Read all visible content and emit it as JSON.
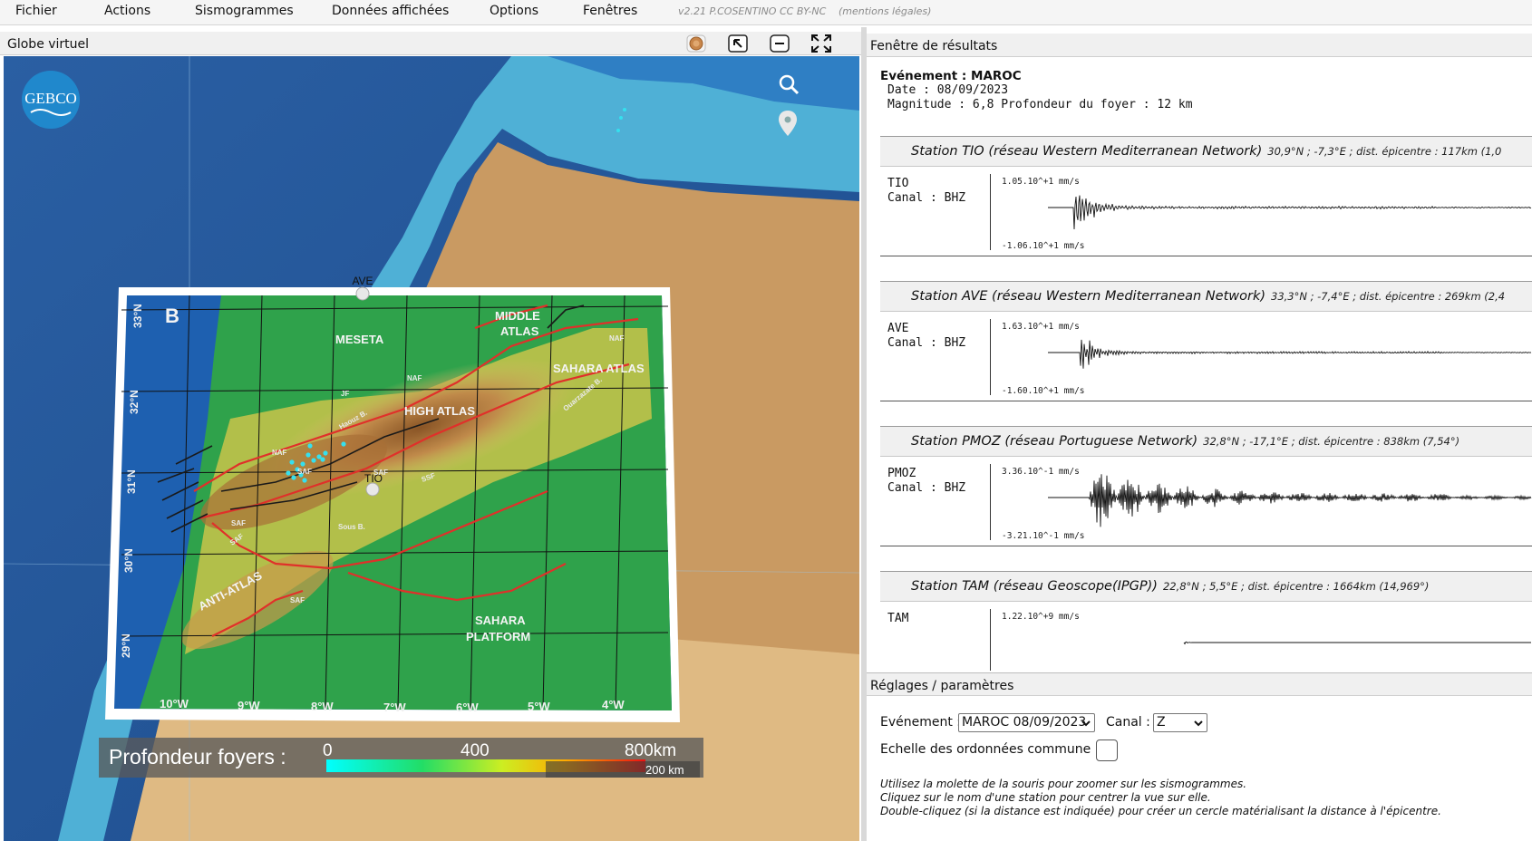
{
  "menubar": {
    "items": [
      "Fichier",
      "Actions",
      "Sismogrammes",
      "Données affichées",
      "Options",
      "Fenêtres"
    ],
    "version": "v2.21 P.COSENTINO CC BY-NC",
    "legal": "(mentions légales)"
  },
  "globe_panel": {
    "title": "Globe virtuel",
    "icons": [
      "globe-texture-icon",
      "select-cursor-icon",
      "minimize-icon",
      "fullscreen-icon",
      "search-icon",
      "location-pin-icon"
    ]
  },
  "map": {
    "gebco_logo": "GEBCO",
    "panel_letter": "B",
    "station_labels": [
      "AVE",
      "TIO"
    ],
    "regions": [
      "MESETA",
      "MIDDLE",
      "ATLAS",
      "SAHARA ATLAS",
      "HIGH ATLAS",
      "ANTI-ATLAS",
      "SAHARA",
      "PLATFORM"
    ],
    "faults": [
      "NAF",
      "NAF",
      "NAF",
      "JF",
      "Haouz B.",
      "SAF",
      "SAF",
      "Sous B.",
      "SSF",
      "Ouarzazate B.",
      "SAF",
      "SAF",
      "SAF"
    ],
    "lat_labels": [
      "33°N",
      "32°N",
      "31°N",
      "30°N",
      "29°N"
    ],
    "lon_labels": [
      "10°W",
      "9°W",
      "8°W",
      "7°W",
      "6°W",
      "5°W",
      "4°W"
    ],
    "legend": {
      "title": "Profondeur foyers :",
      "min": "0",
      "mid": "400",
      "max": "800km"
    },
    "scale": "200 km",
    "colors": {
      "ocean_deep": "#1f4f8f",
      "ocean_shelf": "#4fb0d6",
      "land": "#c99a62",
      "map_low": "#2fa24b",
      "fault": "#e0302a"
    }
  },
  "results_panel": {
    "title": "Fenêtre de résultats",
    "event": {
      "name": "Evénement : MAROC",
      "date": "Date : 08/09/2023",
      "magnitude": "Magnitude : 6,8  Profondeur du foyer : 12 km"
    },
    "stations": [
      {
        "title": "Station TIO (réseau Western Mediterranean Network)",
        "info": "30,9°N ; -7,3°E ; dist. épicentre : 117km (1,0",
        "code": "TIO",
        "canal": "Canal : BHZ",
        "max": "1.05.10^+1 mm/s",
        "min": "-1.06.10^+1 mm/s"
      },
      {
        "title": "Station AVE (réseau Western Mediterranean Network)",
        "info": "33,3°N ; -7,4°E ; dist. épicentre : 269km (2,4",
        "code": "AVE",
        "canal": "Canal : BHZ",
        "max": "1.63.10^+1 mm/s",
        "min": "-1.60.10^+1 mm/s"
      },
      {
        "title": "Station PMOZ (réseau Portuguese Network)",
        "info": "32,8°N ; -17,1°E ; dist. épicentre : 838km (7,54°)",
        "code": "PMOZ",
        "canal": "Canal : BHZ",
        "max": "3.36.10^-1 mm/s",
        "min": "-3.21.10^-1 mm/s"
      },
      {
        "title": "Station TAM (réseau Geoscope(IPGP))",
        "info": "22,8°N ; 5,5°E ; dist. épicentre : 1664km (14,969°)",
        "code": "TAM",
        "canal": "",
        "max": "1.22.10^+9 mm/s",
        "min": ""
      }
    ]
  },
  "settings_panel": {
    "title": "Réglages / paramètres",
    "event_label": "Evénement :",
    "event_value": "MAROC 08/09/2023",
    "canal_label": "Canal :",
    "canal_value": "Z",
    "common_scale_label": "Echelle des ordonnées commune :",
    "common_scale_checked": false,
    "help": [
      "Utilisez la molette de la souris pour zoomer sur les sismogrammes.",
      "Cliquez sur le nom d'une station pour centrer la vue sur elle.",
      "Double-cliquez (si la distance est indiquée) pour créer un cercle matérialisant la distance à l'épicentre."
    ]
  }
}
